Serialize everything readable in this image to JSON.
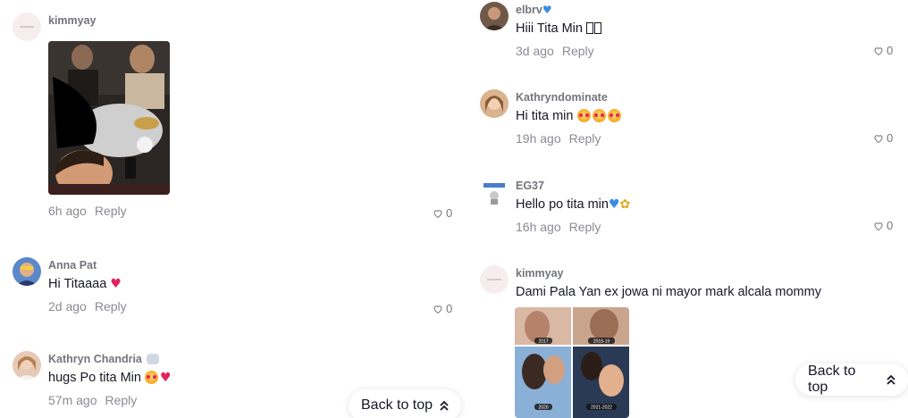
{
  "left": {
    "comments": [
      {
        "username": "kimmyay",
        "text": "",
        "time": "6h ago",
        "reply": "Reply",
        "likes": "0",
        "avatar": "kimmyay-avatar",
        "image": "group-photo"
      },
      {
        "username": "Anna Pat",
        "text": "Hi Titaaaa",
        "emoji": "heart-red",
        "time": "2d ago",
        "reply": "Reply",
        "likes": "0",
        "avatar": "anna-avatar"
      },
      {
        "username": "Kathryn Chandria",
        "badge": "elephant-icon",
        "text": "hugs Po tita Min",
        "emoji": "smile-heart",
        "time": "57m ago",
        "reply": "Reply",
        "likes": "",
        "avatar": "kathryn-avatar"
      }
    ],
    "back_to_top": "Back to top"
  },
  "right": {
    "comments": [
      {
        "username": "elbrv",
        "username_emoji": "blue-heart",
        "text": "Hiii Tita Min",
        "time": "3d ago",
        "reply": "Reply",
        "likes": "0"
      },
      {
        "username": "Kathryndominate",
        "text": "Hi tita min",
        "emoji": "smiling-heart-eyes x3",
        "time": "19h ago",
        "reply": "Reply",
        "likes": "0"
      },
      {
        "username": "EG37",
        "text": "Hello po tita min",
        "emoji": "blue-heart sunflower",
        "time": "16h ago",
        "reply": "Reply",
        "likes": "0"
      },
      {
        "username": "kimmyay",
        "text": "Dami Pala Yan ex jowa ni mayor mark alcala mommy",
        "time": "",
        "reply": "",
        "likes": "",
        "image_labels": [
          "2017",
          "2018-19",
          "2020",
          "2021-2022"
        ]
      }
    ],
    "back_to_top": "Back to top"
  },
  "colors": {
    "username": "#73757c",
    "text": "#161823",
    "meta": "#8a8b91",
    "heart_red": "#e0245e",
    "heart_blue": "#3b8de0"
  }
}
